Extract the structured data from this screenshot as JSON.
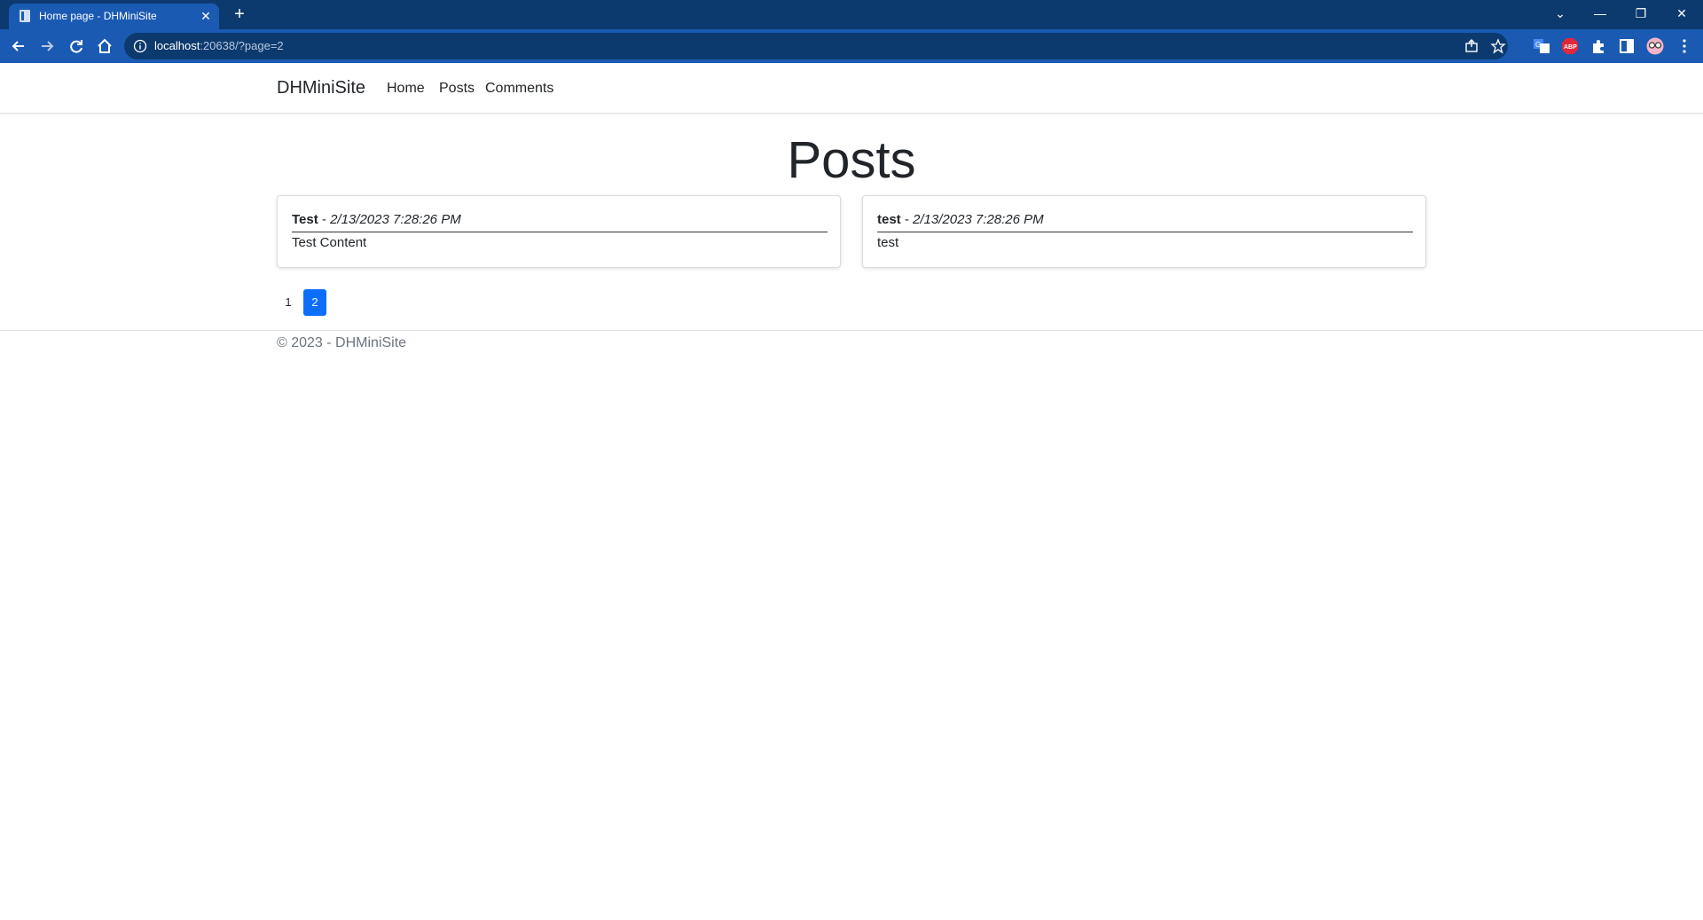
{
  "browser": {
    "tab_title": "Home page - DHMiniSite",
    "tab_close": "✕",
    "new_tab": "+",
    "url_host": "localhost",
    "url_rest": ":20638/?page=2",
    "controls": {
      "chevron": "⌄",
      "minimize": "—",
      "restore": "❐",
      "close": "✕"
    }
  },
  "site": {
    "brand": "DHMiniSite",
    "nav": [
      {
        "label": "Home"
      },
      {
        "label": "Posts"
      },
      {
        "label": "Comments"
      }
    ],
    "heading": "Posts",
    "posts": [
      {
        "title": "Test",
        "separator": " - ",
        "date": "2/13/2023 7:28:26 PM",
        "content": "Test Content"
      },
      {
        "title": "test",
        "separator": " - ",
        "date": "2/13/2023 7:28:26 PM",
        "content": "test"
      }
    ],
    "pagination": {
      "pages": [
        "1",
        "2"
      ],
      "current": "2"
    },
    "footer": "© 2023 - DHMiniSite"
  },
  "colors": {
    "tabbar": "#0d3a6e",
    "toolbar": "#1a5ab3",
    "active_page": "#0d6efd"
  }
}
